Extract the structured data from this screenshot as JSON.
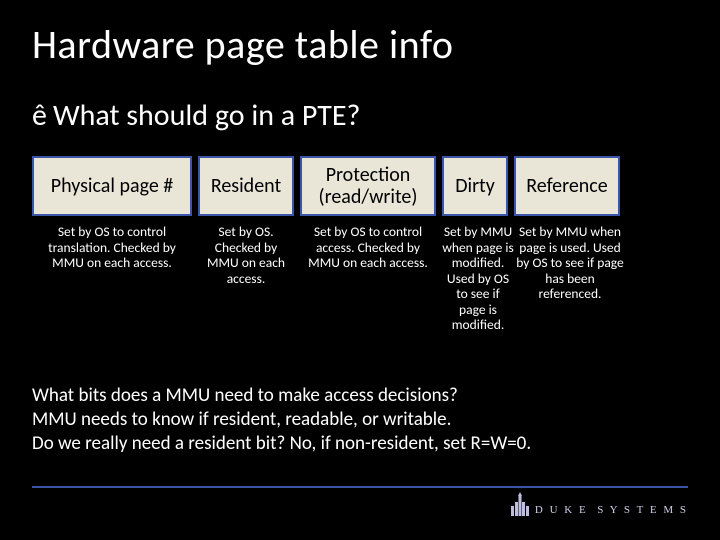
{
  "title": "Hardware page table info",
  "bullet_char": "ê",
  "subtitle": "What should go in a PTE?",
  "headers": {
    "phys": "Physical page #",
    "resident": "Resident",
    "protection": "Protection (read/write)",
    "dirty": "Dirty",
    "reference": "Reference"
  },
  "descriptions": {
    "phys": "Set by OS to control translation.  Checked by MMU on each access.",
    "resident": "Set by OS. Checked by MMU on each access.",
    "protection": "Set by OS to control access. Checked by MMU on each access.",
    "dirty": "Set by MMU when page is modified. Used by OS to see if page is modified.",
    "reference": "Set by MMU when page is used. Used by OS to see if page has been referenced."
  },
  "qa": {
    "line1": "What bits does a MMU need to make access decisions?",
    "line2": "MMU needs to know if resident, readable, or writable.",
    "line3": "Do we really need a resident bit?  No, if non-resident, set R=W=0."
  },
  "footer": {
    "brand1": "D U K E",
    "brand2": "S Y S T E M S"
  }
}
